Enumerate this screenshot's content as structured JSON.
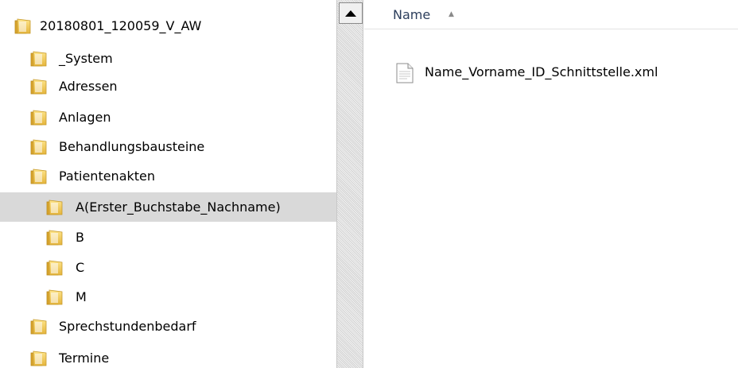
{
  "tree": {
    "root": "20180801_120059_V_AW",
    "items": [
      {
        "label": "_System"
      },
      {
        "label": "Adressen"
      },
      {
        "label": "Anlagen"
      },
      {
        "label": "Behandlungsbausteine"
      },
      {
        "label": "Patientenakten"
      },
      {
        "label": "A(Erster_Buchstabe_Nachname)",
        "selected": true
      },
      {
        "label": "B"
      },
      {
        "label": "C"
      },
      {
        "label": "M"
      },
      {
        "label": "Sprechstundenbedarf"
      },
      {
        "label": "Termine"
      }
    ]
  },
  "list": {
    "column_name": "Name",
    "files": [
      {
        "name": "Name_Vorname_ID_Schnittstelle.xml"
      }
    ]
  },
  "icons": {
    "folder": "folder-icon",
    "file": "xml-file-icon",
    "scroll_up": "scroll-up-arrow-icon",
    "sort": "sort-ascending-icon"
  },
  "colors": {
    "selection": "#d9d9d9",
    "folder_yellow": "#f2c94c",
    "header_text": "#2c3e5c"
  }
}
